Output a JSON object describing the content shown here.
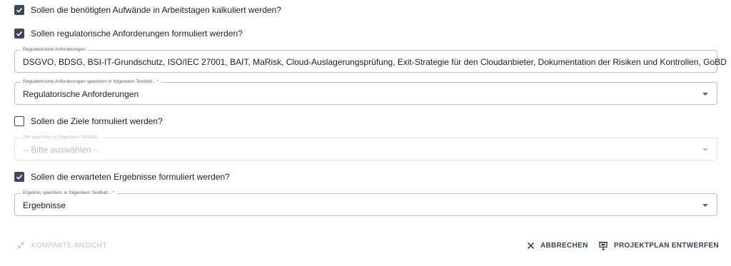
{
  "options": {
    "aufwaende": {
      "label": "Sollen die benötigten Aufwände in Arbeitstagen kalkuliert werden?",
      "checked": true
    },
    "regulatorisch": {
      "label": "Sollen regulatorische Anforderungen formuliert werden?",
      "checked": true
    },
    "ziele": {
      "label": "Sollen die Ziele formuliert werden?",
      "checked": false
    },
    "ergebnisse": {
      "label": "Sollen die erwarteten Ergebnisse formuliert werden?",
      "checked": true
    }
  },
  "fields": {
    "regulatorische_anforderungen": {
      "legend": "Regulatorische Anforderungen",
      "value": "DSGVO, BDSG, BSI-IT-Grundschutz, ISO/IEC 27001, BAIT, MaRisk, Cloud-Auslagerungsprüfung, Exit-Strategie für den Cloudanbieter, Dokumentation der Risiken und Kontrollen, GoBD"
    },
    "regulatorisch_speichern": {
      "legend": "Regulatorische Anforderungen speichern in folgendem Textfeld... *",
      "value": "Regulatorische Anforderungen"
    },
    "ziel_speichern": {
      "legend": "Ziel speichern in folgendem Textfeld...",
      "value": "-- Bitte auswählen --",
      "disabled": true
    },
    "ergebnis_speichern": {
      "legend": "Ergebnis speichern in folgendem Textfeld... *",
      "value": "Ergebnisse"
    }
  },
  "footer": {
    "compact_label": "KOMPAKTE ANSICHT",
    "cancel_label": "ABBRECHEN",
    "plan_label": "PROJEKTPLAN ENTWERFEN"
  },
  "colors": {
    "checkbox": "#3a4a5a",
    "text": "#212121",
    "disabled": "#bdbdbd",
    "button": "#37474f"
  },
  "icons": {
    "checkbox": "check-icon",
    "dropdown": "caret-down-icon",
    "compact": "compress-icon",
    "cancel": "close-icon",
    "plan": "presentation-icon"
  }
}
